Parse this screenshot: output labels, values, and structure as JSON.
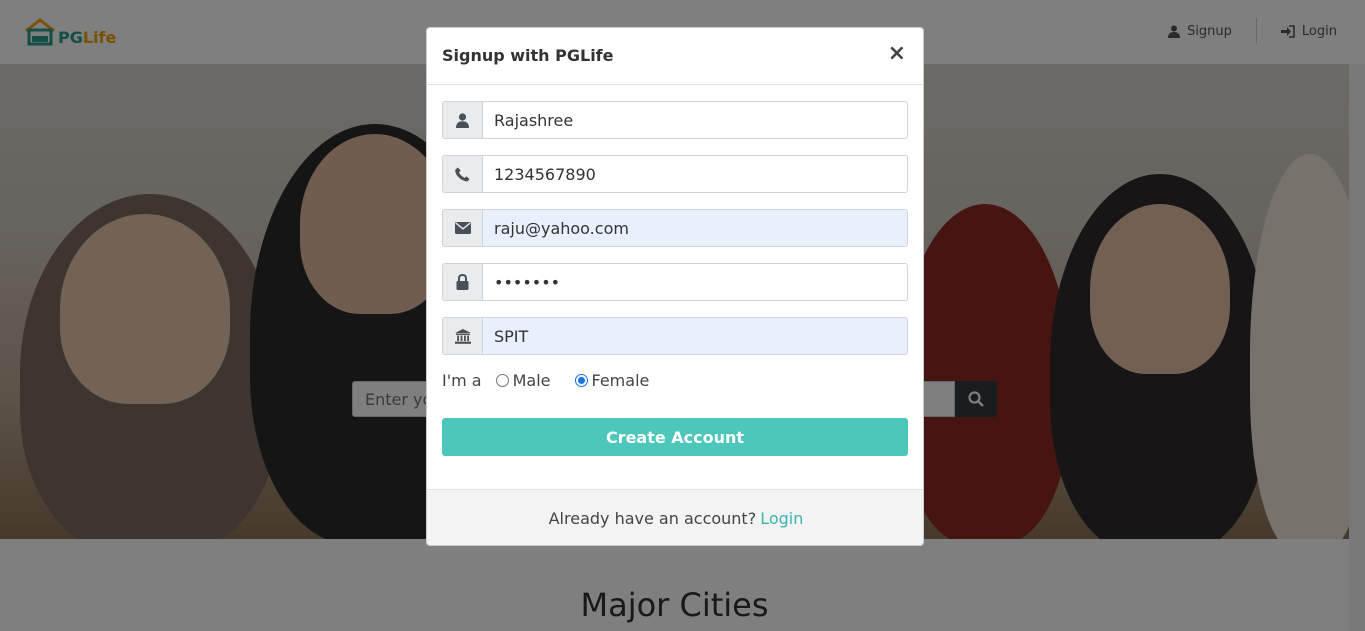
{
  "brand": {
    "name_part1": "PG",
    "name_part2": "Life",
    "colors": {
      "teal": "#2a9d8f",
      "orange": "#f4a300"
    }
  },
  "navbar": {
    "signup_label": "Signup",
    "login_label": "Login"
  },
  "hero": {
    "search_placeholder": "Enter your city to search for PGs"
  },
  "section": {
    "major_cities_title": "Major Cities"
  },
  "modal": {
    "title": "Signup with PGLife",
    "close_symbol": "×",
    "fields": {
      "name": {
        "value": "Rajashree",
        "icon": "user-icon"
      },
      "phone": {
        "value": "1234567890",
        "icon": "phone-icon"
      },
      "email": {
        "value": "raju@yahoo.com",
        "icon": "envelope-icon"
      },
      "password": {
        "value": "•••••••",
        "icon": "lock-icon"
      },
      "college": {
        "value": "SPIT",
        "icon": "university-icon"
      }
    },
    "gender": {
      "prefix": "I'm a",
      "options": [
        "Male",
        "Female"
      ],
      "selected": "Female"
    },
    "submit_label": "Create Account",
    "footer_text": "Already have an account?",
    "footer_link": "Login",
    "accent_color": "#4cc7b9"
  }
}
